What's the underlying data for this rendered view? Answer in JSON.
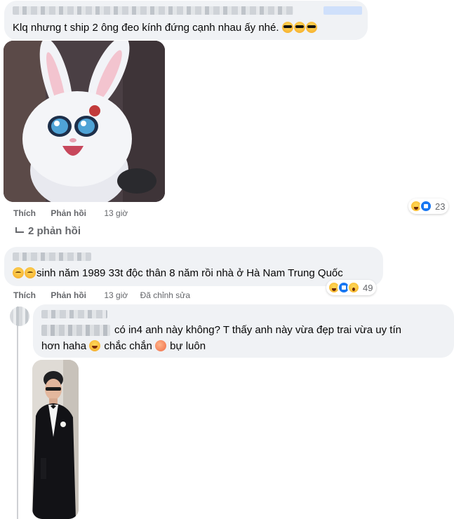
{
  "comment1": {
    "author": "",
    "text": "Klq nhưng t ship 2 ông đeo kính đứng cạnh nhau ấy nhé.",
    "emoji": [
      "smiling-face-with-sunglasses",
      "smiling-face-with-sunglasses",
      "smiling-face-with-sunglasses"
    ],
    "image": "white-bunny-cartoon",
    "actions": {
      "like": "Thích",
      "reply": "Phản hồi",
      "time": "13 giờ"
    },
    "reactions": {
      "icons": [
        "haha",
        "like"
      ],
      "count": "23"
    }
  },
  "replies_toggle": {
    "label": "2 phản hồi"
  },
  "comment2": {
    "author": "",
    "emoji_lead": [
      "relieved-face",
      "relieved-face"
    ],
    "text": "sinh năm 1989 33t độc thân 8 năm rồi nhà ở Hà Nam Trung Quốc",
    "actions": {
      "like": "Thích",
      "reply": "Phản hồi",
      "time": "13 giờ",
      "edited": "Đã chỉnh sửa"
    },
    "reactions": {
      "icons": [
        "haha",
        "like",
        "wow"
      ],
      "count": "49"
    }
  },
  "reply1": {
    "author": "",
    "text_line1": "có in4 anh này không? T thấy anh này vừa đẹp trai vừa uy tín",
    "text_line2_a": "hơn haha",
    "text_line2_b": "chắc chắn",
    "text_line2_c": "bự luôn",
    "image": "man-in-black-tuxedo"
  },
  "colors": {
    "bubble": "#f0f2f5",
    "meta": "#65676b",
    "like_blue": "#1877f2"
  }
}
